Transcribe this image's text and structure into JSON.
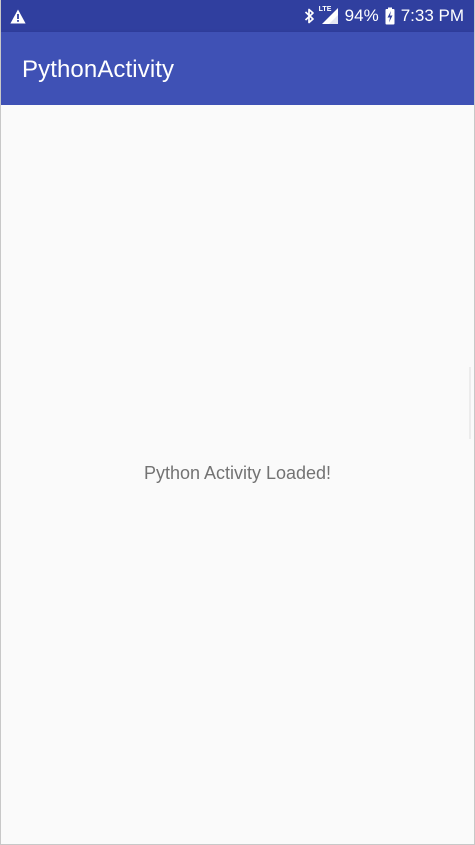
{
  "status_bar": {
    "warning_icon": "warning-triangle-icon",
    "bluetooth_icon": "bluetooth-icon",
    "signal_icon": "lte-signal-icon",
    "network_label": "LTE",
    "battery_percent": "94%",
    "battery_icon": "battery-charging-icon",
    "time": "7:33 PM"
  },
  "app_bar": {
    "title": "PythonActivity"
  },
  "content": {
    "message": "Python Activity Loaded!"
  },
  "colors": {
    "status_bar": "#303f9f",
    "app_bar": "#3f51b5",
    "background": "#fafafa",
    "message_text": "#737373"
  }
}
